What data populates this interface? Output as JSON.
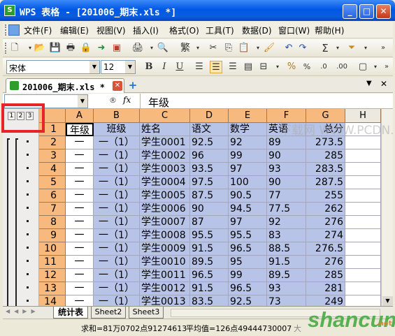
{
  "window": {
    "title": "WPS 表格 - [201006_期末.xls *]",
    "app_icon": "S"
  },
  "menu": [
    "文件(F)",
    "编辑(E)",
    "视图(V)",
    "插入(I)",
    "格式(O)",
    "工具(T)",
    "数据(D)",
    "窗口(W)",
    "帮助(H)"
  ],
  "font": {
    "name": "宋体",
    "size": "12"
  },
  "format_buttons": {
    "bold": "B",
    "italic": "I",
    "underline": "U"
  },
  "toolbar_text": {
    "traditional": "繁",
    "sum": "Σ"
  },
  "doc_tab": {
    "label": "201006_期末.xls *"
  },
  "formula_bar": {
    "name_box": "",
    "fx": "fx",
    "content": "年级"
  },
  "outline_levels": [
    "1",
    "2",
    "3"
  ],
  "columns": [
    "A",
    "B",
    "C",
    "D",
    "E",
    "F",
    "G",
    "H"
  ],
  "rows": [
    {
      "n": "1",
      "cells": [
        "年级",
        "班级",
        "姓名",
        "语文",
        "数学",
        "英语",
        "总分"
      ]
    },
    {
      "n": "2",
      "cells": [
        "一",
        "一（1）",
        "学生0001",
        "92.5",
        "92",
        "89",
        "273.5"
      ]
    },
    {
      "n": "3",
      "cells": [
        "一",
        "一（1）",
        "学生0002",
        "96",
        "99",
        "90",
        "285"
      ]
    },
    {
      "n": "4",
      "cells": [
        "一",
        "一（1）",
        "学生0003",
        "93.5",
        "97",
        "93",
        "283.5"
      ]
    },
    {
      "n": "5",
      "cells": [
        "一",
        "一（1）",
        "学生0004",
        "97.5",
        "100",
        "90",
        "287.5"
      ]
    },
    {
      "n": "6",
      "cells": [
        "一",
        "一（1）",
        "学生0005",
        "87.5",
        "90.5",
        "77",
        "255"
      ]
    },
    {
      "n": "7",
      "cells": [
        "一",
        "一（1）",
        "学生0006",
        "90",
        "94.5",
        "77.5",
        "262"
      ]
    },
    {
      "n": "8",
      "cells": [
        "一",
        "一（1）",
        "学生0007",
        "87",
        "97",
        "92",
        "276"
      ]
    },
    {
      "n": "9",
      "cells": [
        "一",
        "一（1）",
        "学生0008",
        "95.5",
        "95.5",
        "83",
        "274"
      ]
    },
    {
      "n": "10",
      "cells": [
        "一",
        "一（1）",
        "学生0009",
        "91.5",
        "96.5",
        "88.5",
        "276.5"
      ]
    },
    {
      "n": "11",
      "cells": [
        "一",
        "一（1）",
        "学生0010",
        "89.5",
        "95",
        "91.5",
        "276"
      ]
    },
    {
      "n": "12",
      "cells": [
        "一",
        "一（1）",
        "学生0011",
        "96.5",
        "99",
        "89.5",
        "285"
      ]
    },
    {
      "n": "13",
      "cells": [
        "一",
        "一（1）",
        "学生0012",
        "91.5",
        "96.5",
        "93",
        "281"
      ]
    },
    {
      "n": "14",
      "cells": [
        "一",
        "一（1）",
        "学生0013",
        "83.5",
        "92.5",
        "73",
        "249"
      ]
    }
  ],
  "sheets": [
    "统计表",
    "Sheet2",
    "Sheet3"
  ],
  "status": {
    "sum": "求和=81万0702点91274613",
    "avg": "平均值=126点49444730007",
    "extra": "大"
  },
  "watermark": "shancun",
  "watermark_sub": ".net",
  "watermark_text2": "下载网 WWW.PCDN.COM",
  "colors": {
    "highlight_box": "#e8232a",
    "header_orange": "#f7b97d",
    "selection": "#b7c4e8"
  }
}
